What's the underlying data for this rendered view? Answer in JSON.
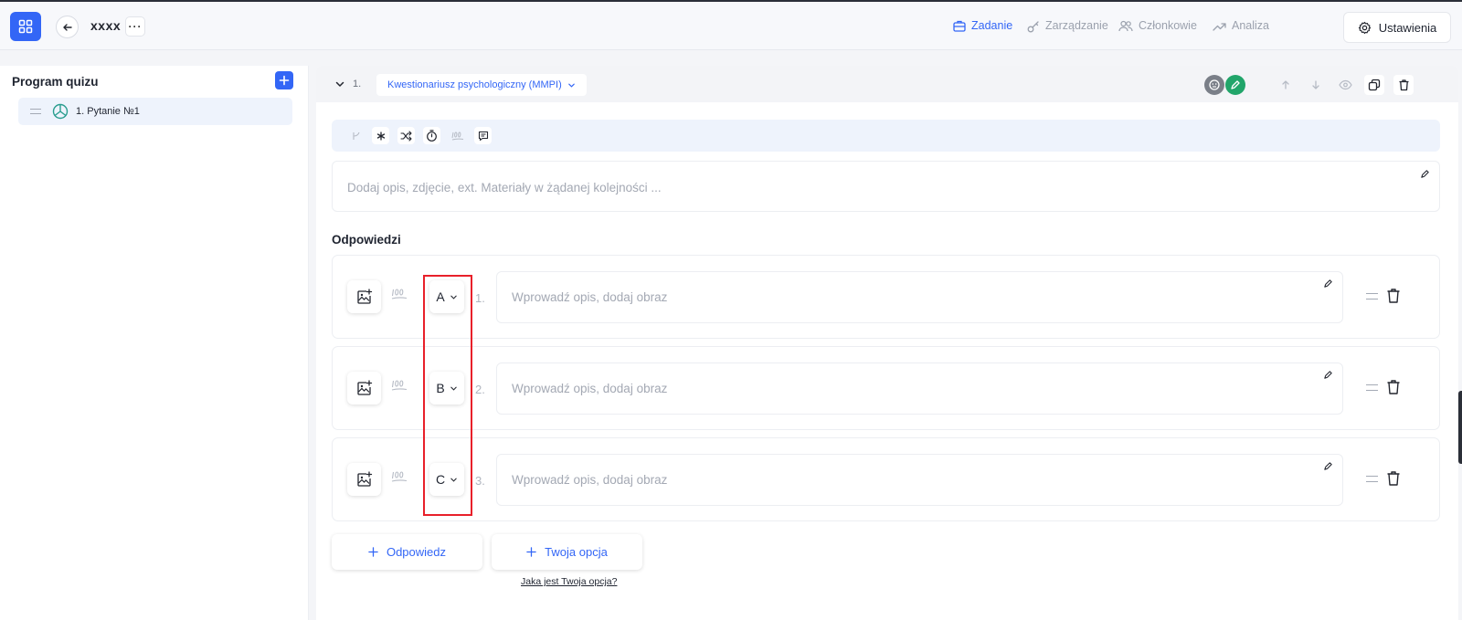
{
  "header": {
    "title": "xxxx",
    "more_label": "···",
    "nav": [
      {
        "label": "Zadanie",
        "icon": "briefcase-icon",
        "active": true
      },
      {
        "label": "Zarządzanie",
        "icon": "key-icon",
        "active": false
      },
      {
        "label": "Członkowie",
        "icon": "users-icon",
        "active": false
      },
      {
        "label": "Analiza",
        "icon": "trend-icon",
        "active": false
      }
    ],
    "settings_label": "Ustawienia"
  },
  "sidebar": {
    "title": "Program quizu",
    "items": [
      {
        "label": "1. Pytanie №1",
        "icon": "pie-chart-icon"
      }
    ]
  },
  "question": {
    "number": "1.",
    "type_label": "Kwestionariusz psychologiczny (MMPI)",
    "description_placeholder": "Dodaj opis, zdjęcie, ext. Materiały w żądanej kolejności ...",
    "answers_title": "Odpowiedzi",
    "answers": [
      {
        "letter": "A",
        "number": "1.",
        "placeholder": "Wprowadź opis, dodaj obraz"
      },
      {
        "letter": "B",
        "number": "2.",
        "placeholder": "Wprowadź opis, dodaj obraz"
      },
      {
        "letter": "C",
        "number": "3.",
        "placeholder": "Wprowadź opis, dodaj obraz"
      }
    ],
    "add_answer_label": "Odpowiedz",
    "add_option_label": "Twoja opcja",
    "help_link": "Jaka jest Twoja opcja?"
  },
  "colors": {
    "accent": "#3366f6",
    "highlight": "#e8202a",
    "status_green": "#21a56a",
    "status_gray": "#7a7f88"
  }
}
